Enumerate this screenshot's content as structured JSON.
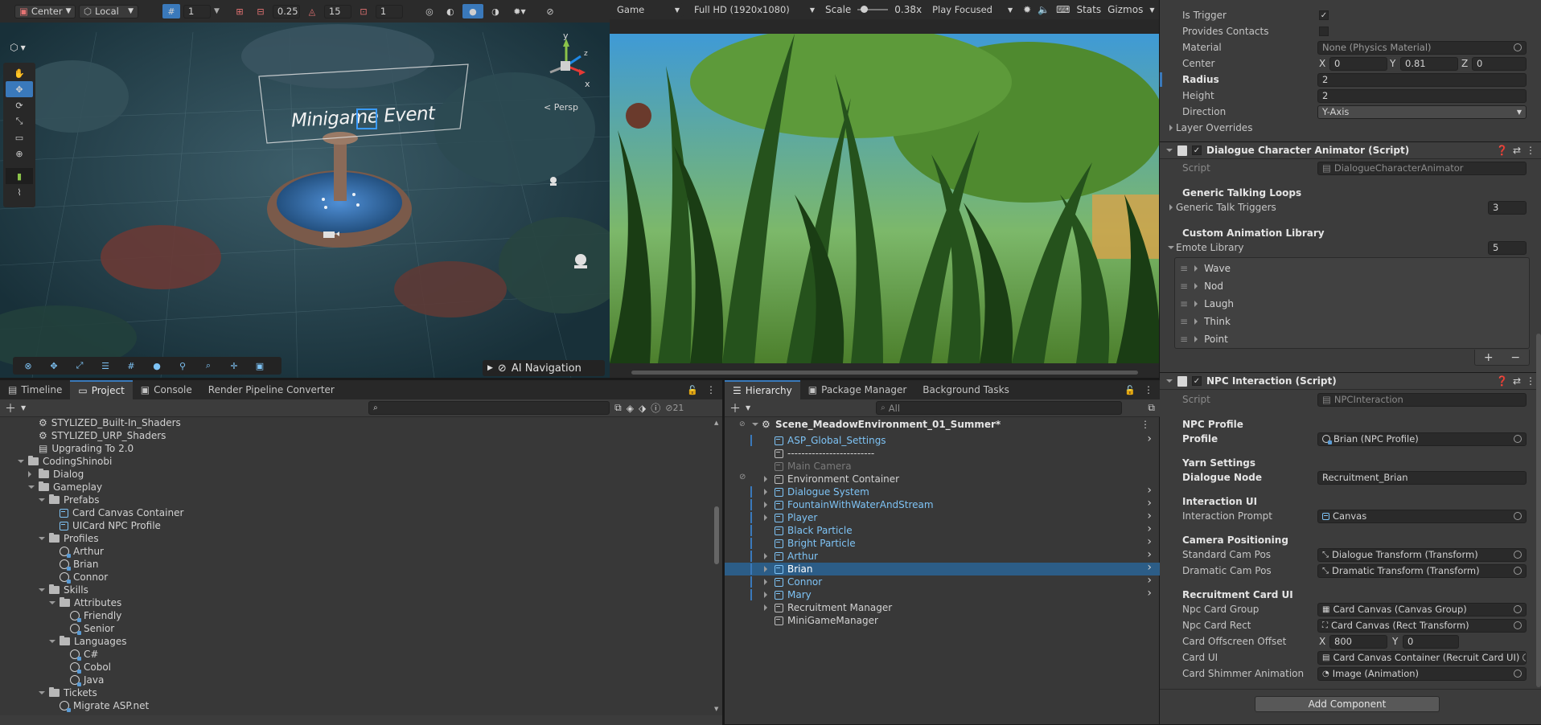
{
  "scene_toolbar": {
    "pivot_mode": "Center",
    "space_mode": "Local",
    "grid_value": "1",
    "snap_move": "0.25",
    "snap_rotate": "15",
    "snap_scale": "1"
  },
  "scene_view": {
    "persp_label": "< Persp",
    "event_label": "Minigame Event",
    "ai_nav_label": "AI Navigation",
    "axis_y": "y",
    "axis_x": "x",
    "axis_z": "z"
  },
  "game_toolbar": {
    "display": "Game",
    "resolution": "Full HD (1920x1080)",
    "scale_label": "Scale",
    "scale_value": "0.38x",
    "play_mode": "Play Focused",
    "stats": "Stats",
    "gizmos": "Gizmos"
  },
  "bottom_left_tabs": [
    "Timeline",
    "Project",
    "Console",
    "Render Pipeline Converter"
  ],
  "project": {
    "search_placeholder": "",
    "hidden_count": "21",
    "items": [
      {
        "label": "STYLIZED_Built-In_Shaders",
        "depth": 1,
        "kind": "asset",
        "expand": "none"
      },
      {
        "label": "STYLIZED_URP_Shaders",
        "depth": 1,
        "kind": "asset",
        "expand": "none"
      },
      {
        "label": "Upgrading To 2.0",
        "depth": 1,
        "kind": "doc",
        "expand": "none"
      },
      {
        "label": "CodingShinobi",
        "depth": 0,
        "kind": "folder",
        "expand": "open"
      },
      {
        "label": "Dialog",
        "depth": 1,
        "kind": "folder",
        "expand": "closed"
      },
      {
        "label": "Gameplay",
        "depth": 1,
        "kind": "folder",
        "expand": "open"
      },
      {
        "label": "Prefabs",
        "depth": 2,
        "kind": "folder",
        "expand": "open"
      },
      {
        "label": "Card Canvas Container",
        "depth": 3,
        "kind": "prefab",
        "expand": "none"
      },
      {
        "label": "UICard NPC Profile",
        "depth": 3,
        "kind": "prefab",
        "expand": "none"
      },
      {
        "label": "Profiles",
        "depth": 2,
        "kind": "folder",
        "expand": "open"
      },
      {
        "label": "Arthur",
        "depth": 3,
        "kind": "so",
        "expand": "none"
      },
      {
        "label": "Brian",
        "depth": 3,
        "kind": "so",
        "expand": "none"
      },
      {
        "label": "Connor",
        "depth": 3,
        "kind": "so",
        "expand": "none"
      },
      {
        "label": "Skills",
        "depth": 2,
        "kind": "folder",
        "expand": "open"
      },
      {
        "label": "Attributes",
        "depth": 3,
        "kind": "folder",
        "expand": "open"
      },
      {
        "label": "Friendly",
        "depth": 4,
        "kind": "so",
        "expand": "none"
      },
      {
        "label": "Senior",
        "depth": 4,
        "kind": "so",
        "expand": "none"
      },
      {
        "label": "Languages",
        "depth": 3,
        "kind": "folder",
        "expand": "open"
      },
      {
        "label": "C#",
        "depth": 4,
        "kind": "so",
        "expand": "none"
      },
      {
        "label": "Cobol",
        "depth": 4,
        "kind": "so",
        "expand": "none"
      },
      {
        "label": "Java",
        "depth": 4,
        "kind": "so",
        "expand": "none"
      },
      {
        "label": "Tickets",
        "depth": 2,
        "kind": "folder",
        "expand": "open"
      },
      {
        "label": "Migrate ASP.net",
        "depth": 3,
        "kind": "so",
        "expand": "none"
      }
    ]
  },
  "hierarchy_tabs": [
    "Hierarchy",
    "Package Manager",
    "Background Tasks"
  ],
  "hierarchy": {
    "search_placeholder": "All",
    "scene_name": "Scene_MeadowEnvironment_01_Summer*",
    "items": [
      {
        "label": "ASP_Global_Settings",
        "style": "prefab",
        "expand": "none",
        "arrow": true
      },
      {
        "label": "-------------------------",
        "style": "plain",
        "expand": "none",
        "arrow": false
      },
      {
        "label": "Main Camera",
        "style": "disabled",
        "expand": "none",
        "arrow": false
      },
      {
        "label": "Environment Container",
        "style": "plain",
        "expand": "closed",
        "arrow": false
      },
      {
        "label": "Dialogue System",
        "style": "prefab",
        "expand": "closed",
        "arrow": true
      },
      {
        "label": "FountainWithWaterAndStream",
        "style": "prefab",
        "expand": "closed",
        "arrow": true
      },
      {
        "label": "Player",
        "style": "prefab",
        "expand": "closed",
        "arrow": true
      },
      {
        "label": "Black Particle",
        "style": "prefab",
        "expand": "none",
        "arrow": true
      },
      {
        "label": "Bright Particle",
        "style": "prefab",
        "expand": "none",
        "arrow": true
      },
      {
        "label": "Arthur",
        "style": "prefab",
        "expand": "closed",
        "arrow": true
      },
      {
        "label": "Brian",
        "style": "selected",
        "expand": "closed",
        "arrow": true
      },
      {
        "label": "Connor",
        "style": "prefab",
        "expand": "closed",
        "arrow": true
      },
      {
        "label": "Mary",
        "style": "prefab",
        "expand": "closed",
        "arrow": true
      },
      {
        "label": "Recruitment Manager",
        "style": "plain",
        "expand": "closed",
        "arrow": false
      },
      {
        "label": "MiniGameManager",
        "style": "plain",
        "expand": "none",
        "arrow": false
      }
    ]
  },
  "inspector": {
    "collider": {
      "is_trigger_label": "Is Trigger",
      "provides_contacts_label": "Provides Contacts",
      "material_label": "Material",
      "material_value": "None (Physics Material)",
      "center_label": "Center",
      "center_x_label": "X",
      "center_x": "0",
      "center_y_label": "Y",
      "center_y": "0.81",
      "center_z_label": "Z",
      "center_z": "0",
      "radius_label": "Radius",
      "radius_value": "2",
      "height_label": "Height",
      "height_value": "2",
      "direction_label": "Direction",
      "direction_value": "Y-Axis",
      "layer_overrides_label": "Layer Overrides"
    },
    "dialogue_animator": {
      "title": "Dialogue Character Animator (Script)",
      "script_label": "Script",
      "script_value": "DialogueCharacterAnimator",
      "generic_header": "Generic Talking Loops",
      "generic_triggers_label": "Generic Talk Triggers",
      "generic_triggers_count": "3",
      "custom_header": "Custom Animation Library",
      "emote_label": "Emote Library",
      "emote_count": "5",
      "emotes": [
        "Wave",
        "Nod",
        "Laugh",
        "Think",
        "Point"
      ],
      "add_label": "+",
      "remove_label": "−"
    },
    "npc_interaction": {
      "title": "NPC Interaction (Script)",
      "script_label": "Script",
      "script_value": "NPCInteraction",
      "profile_header": "NPC Profile",
      "profile_label": "Profile",
      "profile_value": "Brian (NPC Profile)",
      "yarn_header": "Yarn Settings",
      "dialogue_node_label": "Dialogue Node",
      "dialogue_node_value": "Recruitment_Brian",
      "ui_header": "Interaction UI",
      "prompt_label": "Interaction Prompt",
      "prompt_value": "Canvas",
      "camera_header": "Camera Positioning",
      "standard_label": "Standard Cam Pos",
      "standard_value": "Dialogue Transform (Transform)",
      "dramatic_label": "Dramatic Cam Pos",
      "dramatic_value": "Dramatic Transform (Transform)",
      "card_header": "Recruitment Card UI",
      "group_label": "Npc Card Group",
      "group_value": "Card Canvas (Canvas Group)",
      "rect_label": "Npc Card Rect",
      "rect_value": "Card Canvas (Rect Transform)",
      "offset_label": "Card Offscreen Offset",
      "offset_x_label": "X",
      "offset_x": "800",
      "offset_y_label": "Y",
      "offset_y": "0",
      "card_ui_label": "Card UI",
      "card_ui_value": "Card Canvas Container (Recruit Card UI)",
      "shimmer_label": "Card Shimmer Animation",
      "shimmer_value": "Image (Animation)"
    },
    "add_component": "Add Component"
  },
  "colors": {
    "accent": "#3a79bb",
    "selected_row": "#2c5d87",
    "prefab_text": "#7ec3f5"
  }
}
